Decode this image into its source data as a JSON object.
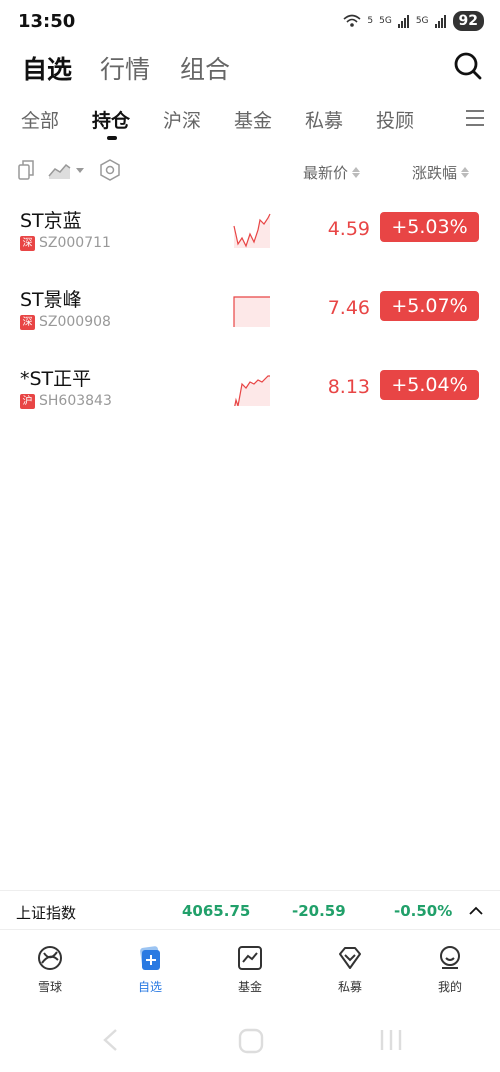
{
  "status_bar": {
    "time": "13:50",
    "wifi_label": "5",
    "network1": "5G",
    "network2": "5G",
    "battery": "92"
  },
  "header": {
    "tabs": [
      {
        "label": "自选"
      },
      {
        "label": "行情"
      },
      {
        "label": "组合"
      }
    ]
  },
  "subtabs": [
    {
      "label": "全部"
    },
    {
      "label": "持仓"
    },
    {
      "label": "沪深"
    },
    {
      "label": "基金"
    },
    {
      "label": "私募"
    },
    {
      "label": "投顾"
    }
  ],
  "toolbar": {
    "col_price": "最新价",
    "col_change": "涨跌幅"
  },
  "colors": {
    "up": "#e84545",
    "down": "#21a06a",
    "accent": "#2a7ae2"
  },
  "stocks": [
    {
      "name": "ST京蓝",
      "market": "深",
      "code": "SZ000711",
      "price": "4.59",
      "change": "+5.03%"
    },
    {
      "name": "ST景峰",
      "market": "深",
      "code": "SZ000908",
      "price": "7.46",
      "change": "+5.07%"
    },
    {
      "name": "*ST正平",
      "market": "沪",
      "code": "SH603843",
      "price": "8.13",
      "change": "+5.04%"
    }
  ],
  "index_bar": {
    "name": "上证指数",
    "value": "4065.75",
    "change": "-20.59",
    "change_pct": "-0.50%"
  },
  "bottom_nav": [
    {
      "label": "雪球",
      "icon": "snowball-icon"
    },
    {
      "label": "自选",
      "icon": "watchlist-icon"
    },
    {
      "label": "基金",
      "icon": "fund-chart-icon"
    },
    {
      "label": "私募",
      "icon": "diamond-icon"
    },
    {
      "label": "我的",
      "icon": "profile-icon"
    }
  ]
}
